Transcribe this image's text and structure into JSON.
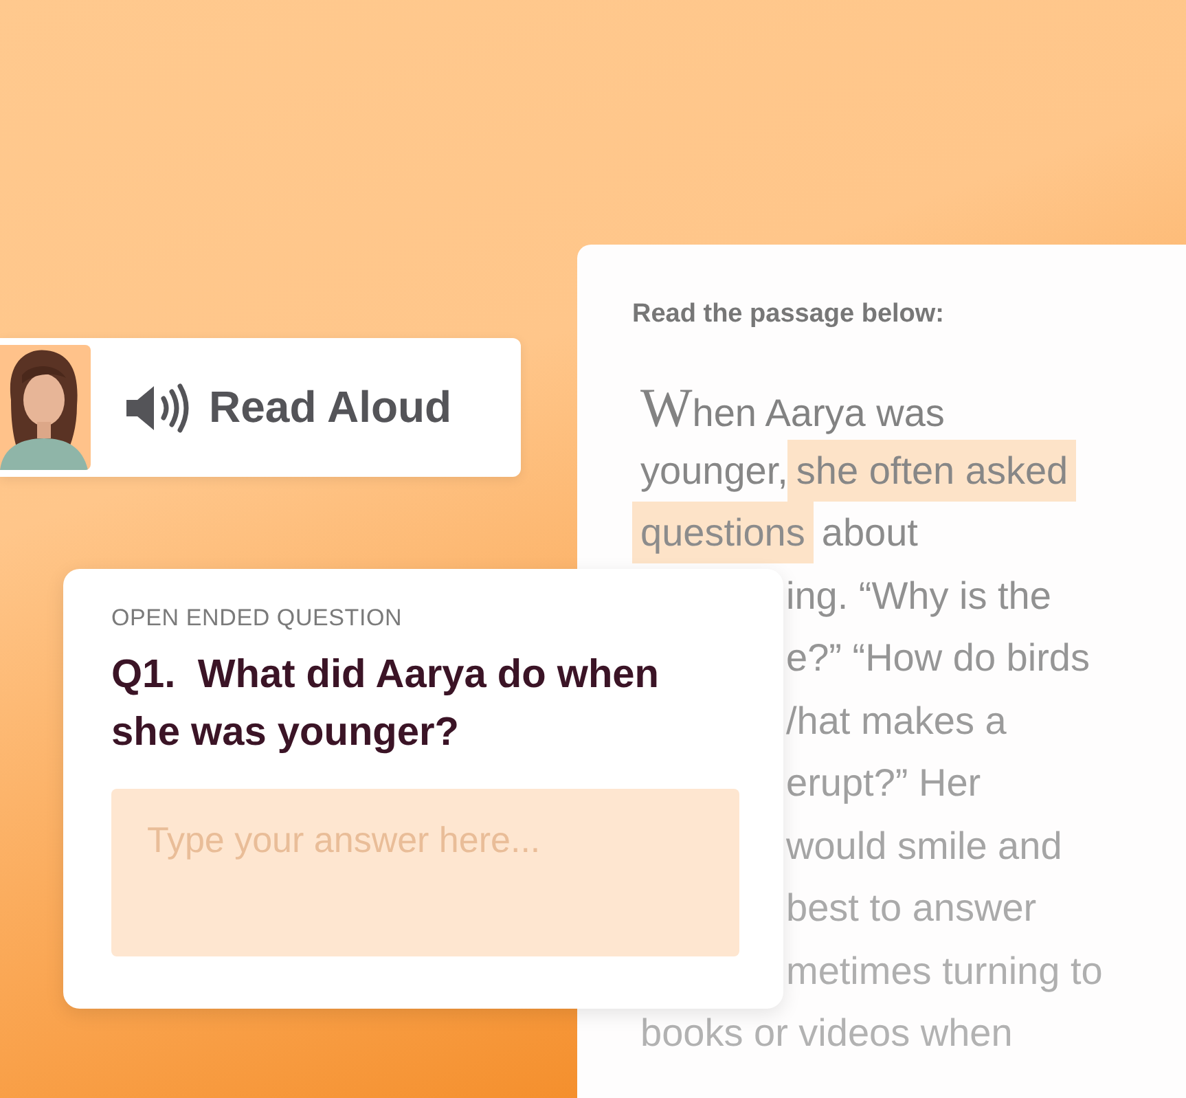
{
  "read_aloud": {
    "label": "Read Aloud"
  },
  "passage": {
    "heading": "Read the passage below:",
    "lines": [
      {
        "segments": [
          {
            "kind": "initial",
            "text": "W"
          },
          {
            "kind": "plain",
            "text": "hen Aarya was"
          }
        ]
      },
      {
        "segments": [
          {
            "kind": "plain",
            "text": "younger,"
          },
          {
            "kind": "highlight",
            "text": "she often asked"
          }
        ]
      },
      {
        "segments": [
          {
            "kind": "highlight",
            "text": "questions"
          },
          {
            "kind": "plain",
            "text": "about"
          }
        ]
      },
      {
        "segments": [
          {
            "kind": "cut",
            "text": "ing. “Why is the"
          }
        ]
      },
      {
        "segments": [
          {
            "kind": "cut",
            "text": "e?” “How do birds"
          }
        ]
      },
      {
        "segments": [
          {
            "kind": "cut",
            "text": "/hat makes a"
          }
        ]
      },
      {
        "segments": [
          {
            "kind": "cut",
            "text": "erupt?” Her"
          }
        ]
      },
      {
        "segments": [
          {
            "kind": "cut",
            "text": "would smile and"
          }
        ]
      },
      {
        "segments": [
          {
            "kind": "cut",
            "text": "best to answer"
          }
        ]
      },
      {
        "segments": [
          {
            "kind": "cut",
            "text": "metimes turning to"
          }
        ]
      },
      {
        "segments": [
          {
            "kind": "plain",
            "text": "books or videos when"
          }
        ]
      }
    ]
  },
  "question": {
    "type_label": "OPEN ENDED QUESTION",
    "title": "Q1.  What did Aarya do when she was younger?",
    "answer": {
      "placeholder": "Type your answer here..."
    }
  }
}
